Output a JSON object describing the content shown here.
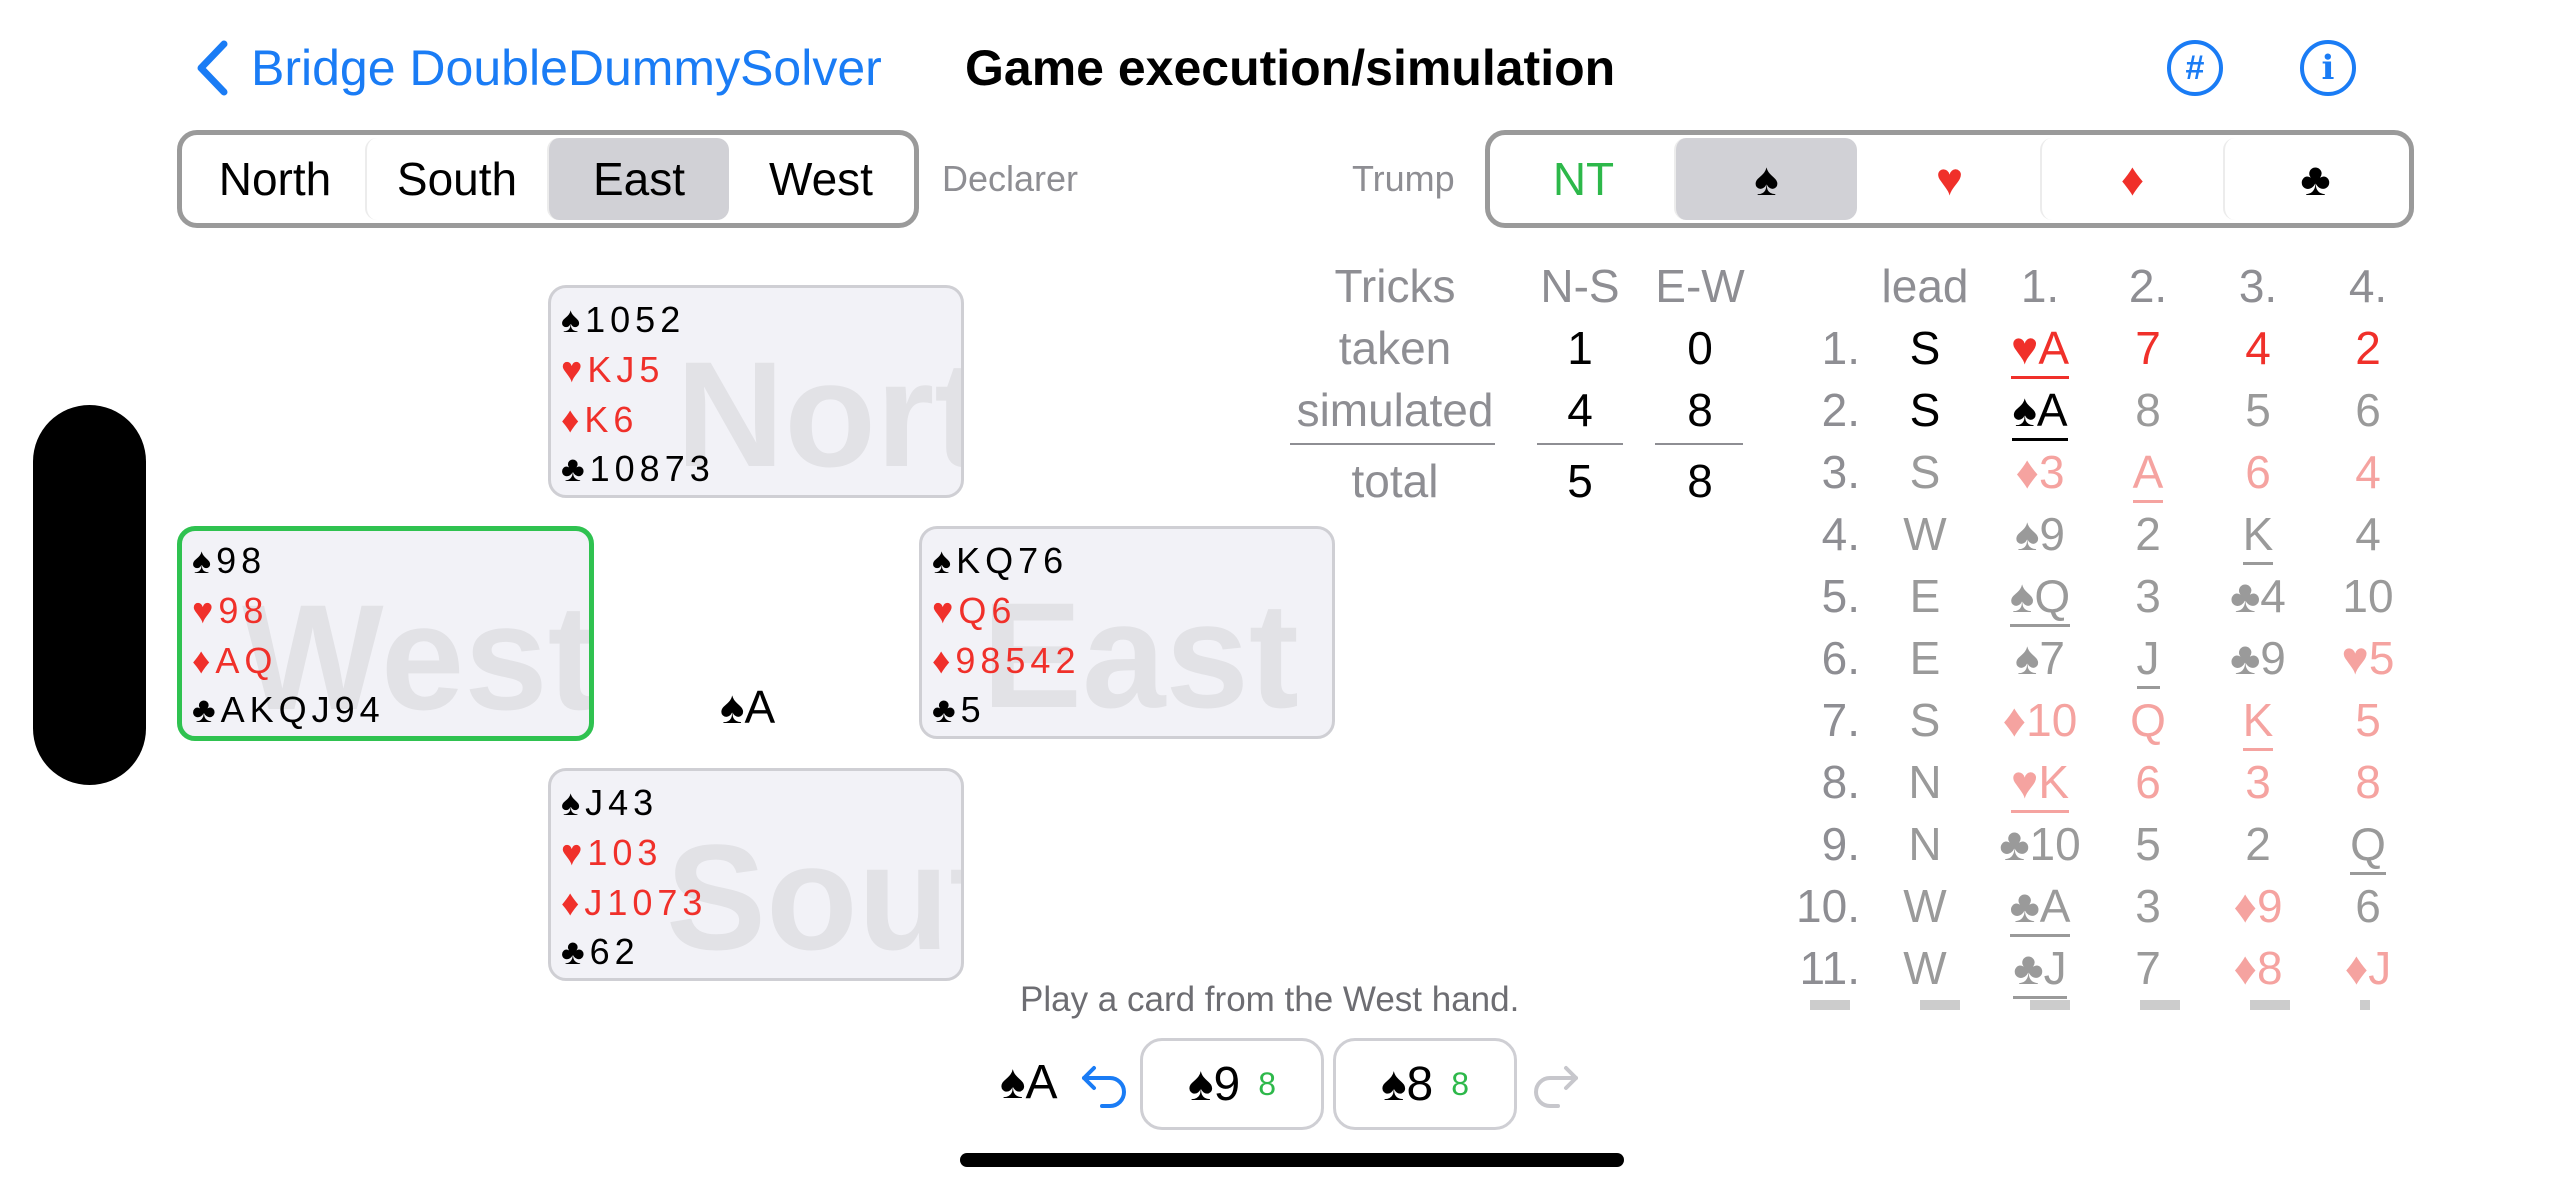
{
  "header": {
    "back_label": "Bridge DoubleDummySolver",
    "title": "Game execution/simulation",
    "hash_icon": "#",
    "info_icon": "i"
  },
  "declarer": {
    "label": "Declarer",
    "options": [
      "North",
      "South",
      "East",
      "West"
    ],
    "selected": "East"
  },
  "trump": {
    "label": "Trump",
    "options": [
      "NT",
      "♠",
      "♥",
      "♦",
      "♣"
    ],
    "selected": "♠"
  },
  "hands": {
    "north": {
      "watermark": "North",
      "spades": "♠1052",
      "hearts": "♥KJ5",
      "diamonds": "♦K6",
      "clubs": "♣10873"
    },
    "west": {
      "watermark": "West",
      "spades": "♠98",
      "hearts": "♥98",
      "diamonds": "♦AQ",
      "clubs": "♣AKQJ94"
    },
    "east": {
      "watermark": "East",
      "spades": "♠KQ76",
      "hearts": "♥Q6",
      "diamonds": "♦98542",
      "clubs": "♣5"
    },
    "south": {
      "watermark": "South",
      "spades": "♠J43",
      "hearts": "♥103",
      "diamonds": "♦J1073",
      "clubs": "♣62"
    }
  },
  "played_card": "♠A",
  "score": {
    "headers": [
      "Tricks",
      "N-S",
      "E-W"
    ],
    "rows": [
      {
        "label": "taken",
        "ns": "1",
        "ew": "0"
      },
      {
        "label": "simulated",
        "ns": "4",
        "ew": "8"
      },
      {
        "label": "total",
        "ns": "5",
        "ew": "8"
      }
    ]
  },
  "tricks_table": {
    "headers": [
      "lead",
      "1.",
      "2.",
      "3.",
      "4."
    ],
    "rows": [
      {
        "n": "1.",
        "lead": "S",
        "c": [
          "♥A",
          "7",
          "4",
          "2"
        ]
      },
      {
        "n": "2.",
        "lead": "S",
        "c": [
          "♠A",
          "8",
          "5",
          "6"
        ]
      },
      {
        "n": "3.",
        "lead": "S",
        "c": [
          "♦3",
          "A",
          "6",
          "4"
        ]
      },
      {
        "n": "4.",
        "lead": "W",
        "c": [
          "♠9",
          "2",
          "K",
          "4"
        ]
      },
      {
        "n": "5.",
        "lead": "E",
        "c": [
          "♠Q",
          "3",
          "♣4",
          "10"
        ]
      },
      {
        "n": "6.",
        "lead": "E",
        "c": [
          "♠7",
          "J",
          "♣9",
          "♥5"
        ]
      },
      {
        "n": "7.",
        "lead": "S",
        "c": [
          "♦10",
          "Q",
          "K",
          "5"
        ]
      },
      {
        "n": "8.",
        "lead": "N",
        "c": [
          "♥K",
          "6",
          "3",
          "8"
        ]
      },
      {
        "n": "9.",
        "lead": "N",
        "c": [
          "♣10",
          "5",
          "2",
          "Q"
        ]
      },
      {
        "n": "10.",
        "lead": "W",
        "c": [
          "♣A",
          "3",
          "♦9",
          "6"
        ]
      },
      {
        "n": "11.",
        "lead": "W",
        "c": [
          "♣J",
          "7",
          "♦8",
          "♦J"
        ]
      }
    ]
  },
  "status_message": "Play a card from the West hand.",
  "bottom": {
    "last_played": "♠A",
    "options": [
      {
        "card": "♠9",
        "count": "8"
      },
      {
        "card": "♠8",
        "count": "8"
      }
    ]
  },
  "colors": {
    "accent": "#1a7cf5",
    "red": "#f0302a",
    "green": "#2db84a",
    "selected_segment": "#d1d1d6"
  }
}
